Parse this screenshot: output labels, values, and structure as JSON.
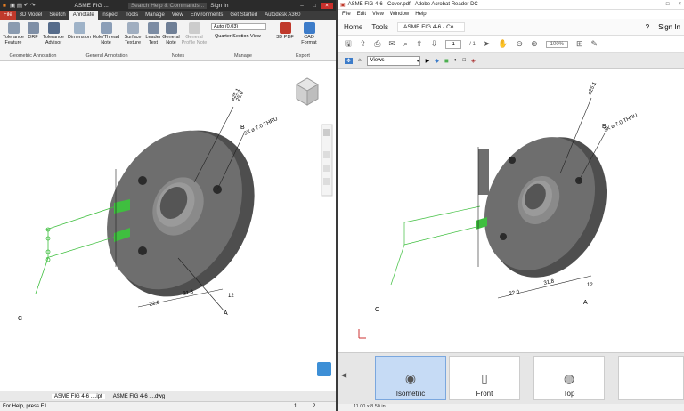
{
  "inventor": {
    "title": "ASME FIG ...",
    "search_placeholder": "Search Help & Commands...",
    "sign_in": "Sign In",
    "tabs": [
      "File",
      "3D Model",
      "Sketch",
      "Annotate",
      "Inspect",
      "Tools",
      "Manage",
      "View",
      "Environments",
      "Get Started",
      "Autodesk A360"
    ],
    "active_tab": "Annotate",
    "ribbon_buttons": [
      {
        "label": "Tolerance Feature"
      },
      {
        "label": "DRF"
      },
      {
        "label": "Tolerance Advisor"
      },
      {
        "label": "Dimension"
      },
      {
        "label": "Hole/Thread Note"
      },
      {
        "label": "Surface Texture"
      },
      {
        "label": "Leader Text"
      },
      {
        "label": "General Note"
      },
      {
        "label": "General Profile Note"
      },
      {
        "label": "3D PDF"
      },
      {
        "label": "CAD Format"
      }
    ],
    "auto_value": "Auto (0.03)",
    "section_view": "Quarter Section View",
    "groups": [
      "Geometric Annotation",
      "General Annotation",
      "Notes",
      "Manage",
      "Export"
    ],
    "doc_tabs": [
      "ASME FIG 4-6 ....ipt",
      "ASME FIG 4-6 ....dwg"
    ],
    "status": "For Help, press F1",
    "status_nums": [
      "1",
      "2"
    ]
  },
  "acrobat": {
    "title": "ASME FIG 4-6 - Cover.pdf - Adobe Acrobat Reader DC",
    "menu": [
      "File",
      "Edit",
      "View",
      "Window",
      "Help"
    ],
    "tabs": [
      "Home",
      "Tools",
      "ASME FIG 4-6 - Co..."
    ],
    "sign_in": "Sign In",
    "page_current": "1",
    "page_total": "/ 1",
    "zoom": "100%",
    "views_label": "Views",
    "thumbnails": [
      "Isometric",
      "Front",
      "Top"
    ],
    "selected_thumbnail": "Isometric",
    "page_size": "11.00 x 8.50 in"
  },
  "drawing": {
    "dim_phi": "⌀25.1",
    "dim_phi2": "25.0",
    "holes": "3X ⌀ 7.0 THRU",
    "dim_22": "22.0",
    "dim_318": "31.8",
    "datum_a": "A",
    "datum_b": "B",
    "datum_c": "C",
    "fcf": "⌀0.2 A B C",
    "flat": "12"
  },
  "colors": {
    "part": "#6e6e6e",
    "face_highlight": "#3fbf3f",
    "file_tab": "#c0392b"
  }
}
